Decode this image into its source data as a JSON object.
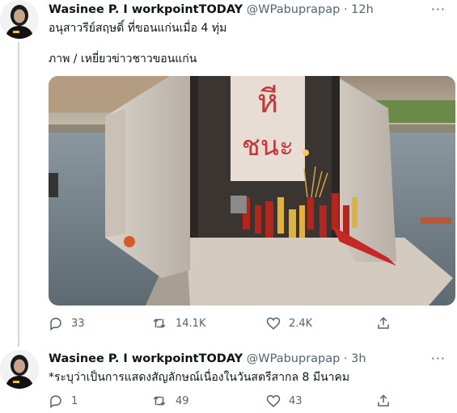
{
  "tweets": [
    {
      "author_name": "Wasinee P. I workpointTODAY",
      "handle": "@WPabuprapap",
      "separator": "·",
      "time": "12h",
      "more_label": "···",
      "lines": [
        "อนุสาวรีย์สฤษดิ์ ที่ขอนแก่นเมื่อ 4 ทุ่ม",
        "ภาพ / เหยี่ยวข่าวชาวขอนแก่น"
      ],
      "media": {
        "sign_text_line1": "หี",
        "sign_text_line2": "ชนะ"
      },
      "replies": "33",
      "retweets": "14.1K",
      "likes": "2.4K"
    },
    {
      "author_name": "Wasinee P. I workpointTODAY",
      "handle": "@WPabuprapap",
      "separator": "·",
      "time": "3h",
      "more_label": "···",
      "lines": [
        "*ระบุว่าเป็นการแสดงสัญลักษณ์เนื่องในวันสตรีสากล 8 มีนาคม"
      ],
      "replies": "1",
      "retweets": "49",
      "likes": "43"
    }
  ],
  "colors": {
    "text": "#0f1419",
    "muted": "#536471",
    "thread_line": "#cfd9de"
  },
  "icons": [
    "reply-icon",
    "retweet-icon",
    "like-icon",
    "share-icon",
    "more-icon"
  ]
}
